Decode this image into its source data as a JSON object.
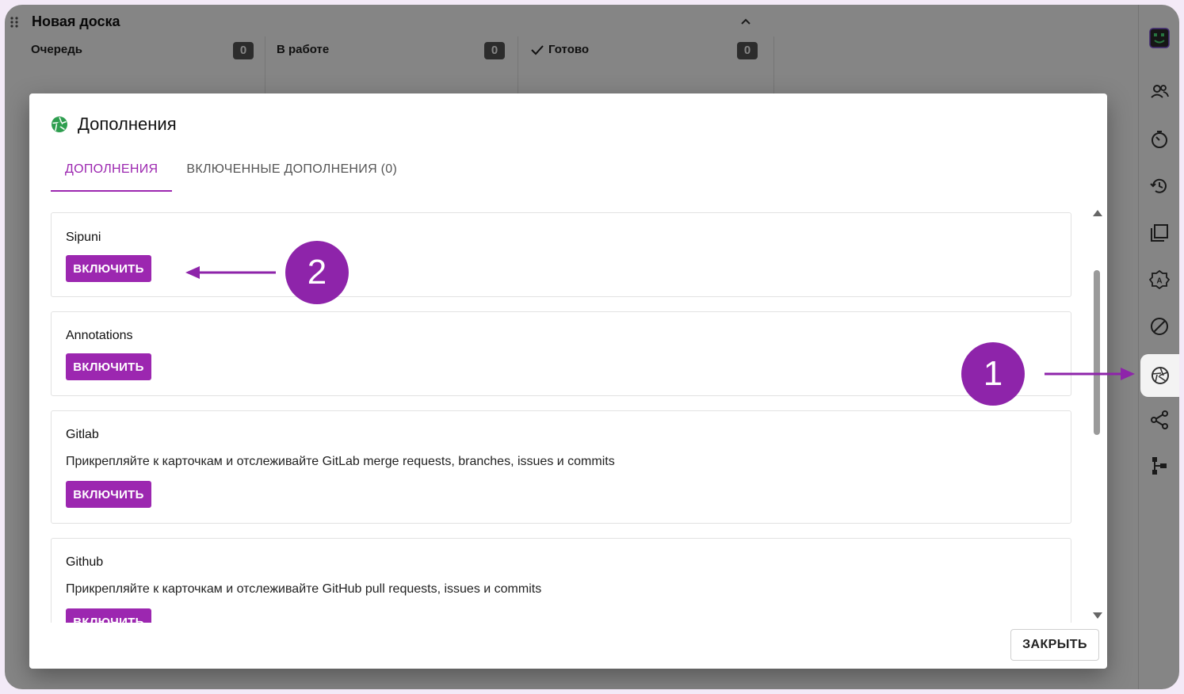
{
  "board": {
    "title": "Новая доска",
    "columns": [
      {
        "label": "Очередь",
        "count": "0"
      },
      {
        "label": "В работе",
        "count": "0"
      },
      {
        "label": "Готово",
        "count": "0"
      }
    ]
  },
  "dialog": {
    "title": "Дополнения",
    "tabs": [
      {
        "label": "ДОПОЛНЕНИЯ"
      },
      {
        "label": "ВКЛЮЧЕННЫЕ ДОПОЛНЕНИЯ (0)"
      }
    ],
    "addons": [
      {
        "name": "Sipuni",
        "desc": "",
        "button": "ВКЛЮЧИТЬ"
      },
      {
        "name": "Annotations",
        "desc": "",
        "button": "ВКЛЮЧИТЬ"
      },
      {
        "name": "Gitlab",
        "desc": "Прикрепляйте к карточкам и отслеживайте GitLab merge requests, branches, issues и commits",
        "button": "ВКЛЮЧИТЬ"
      },
      {
        "name": "Github",
        "desc": "Прикрепляйте к карточкам и отслеживайте GitHub pull requests, issues и commits",
        "button": "ВКЛЮЧИТЬ"
      }
    ],
    "close_label": "ЗАКРЫТЬ"
  },
  "annotations": {
    "marker1": "1",
    "marker2": "2",
    "accent": "#8e24aa"
  },
  "colors": {
    "primary": "#9c27b0",
    "success_icon": "#2e9e4f"
  },
  "sidebar_icons": [
    "app-logo-icon",
    "members-icon",
    "timer-icon",
    "history-icon",
    "copy-icon",
    "settings-auto-icon",
    "block-icon",
    "addons-aperture-icon",
    "share-icon",
    "hierarchy-icon"
  ]
}
